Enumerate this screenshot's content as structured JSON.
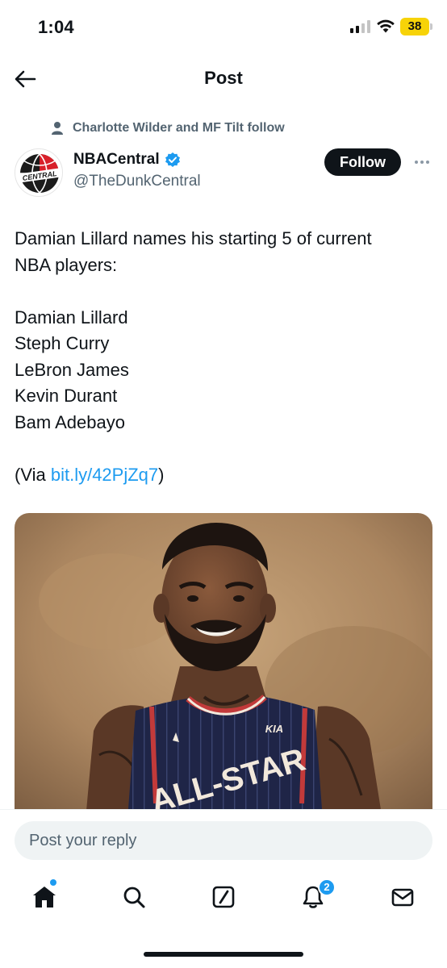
{
  "status_bar": {
    "time": "1:04",
    "battery": "38",
    "battery_color": "#f7d308",
    "signal_icon": "cellular-signal-icon",
    "wifi_icon": "wifi-icon"
  },
  "header": {
    "title": "Post",
    "back_icon": "arrow-left-icon"
  },
  "social_context": {
    "icon": "person-icon",
    "text": "Charlotte Wilder and MF Tilt follow"
  },
  "author": {
    "name": "NBACentral",
    "handle": "@TheDunkCentral",
    "verified_icon": "verified-badge-icon",
    "verified_color": "#1d9bf0",
    "avatar_text": "CENTRAL",
    "follow_label": "Follow",
    "more_icon": "more-horizontal-icon"
  },
  "post": {
    "lines": [
      "Damian Lillard names his starting 5 of current",
      "NBA players:"
    ],
    "players": [
      "Damian Lillard",
      "Steph Curry",
      "LeBron James",
      "Kevin Durant",
      "Bam Adebayo"
    ],
    "via_prefix": "(Via ",
    "via_link": "bit.ly/42PjZq7",
    "via_suffix": ")",
    "link_color": "#1d9bf0"
  },
  "media": {
    "jersey_text": "ALL-STAR",
    "jersey_logo": "KIA"
  },
  "reply": {
    "placeholder": "Post your reply"
  },
  "nav": {
    "items": [
      {
        "icon": "home-icon",
        "active": true
      },
      {
        "icon": "search-icon"
      },
      {
        "icon": "grok-icon"
      },
      {
        "icon": "bell-icon",
        "badge": "2"
      },
      {
        "icon": "mail-icon"
      }
    ],
    "accent": "#1d9bf0"
  }
}
